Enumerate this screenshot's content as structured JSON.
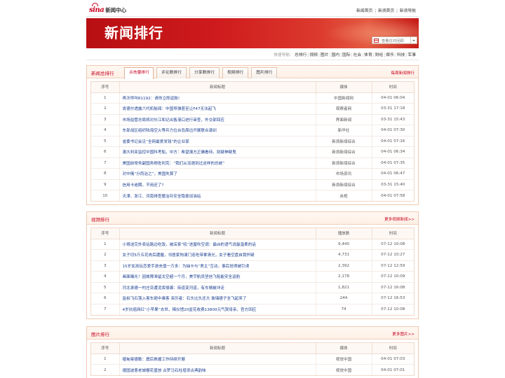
{
  "header": {
    "logo_brand": "sina",
    "logo_text": "新闻中心",
    "links": [
      "新闻首页",
      "新浪首页",
      "新浪导航"
    ],
    "link_separator": "|"
  },
  "banner": {
    "title": "新闻排行",
    "date_placeholder": "查看往日回顾"
  },
  "quicknav": {
    "label": "快速导航:",
    "items": [
      "总排行",
      "视频",
      "图片",
      "国内",
      "国际",
      "社会",
      "体育",
      "财经",
      "娱乐",
      "科技",
      "军事"
    ]
  },
  "news_panel": {
    "title": "新闻总排行",
    "more": "每周新闻排行",
    "tabs": [
      "点击量排行",
      "评论数排行",
      "分享数排行",
      "视频排行",
      "图片排行"
    ],
    "active_tab": 0,
    "columns": [
      "序号",
      "新闻标题",
      "媒体",
      "时间"
    ],
    "rows": [
      {
        "n": "1",
        "title": "再次呼叫81192：请你立即返航!",
        "media": "中国新闻网",
        "time": "04-01 06:04"
      },
      {
        "n": "2",
        "title": "肯德尔透露六代机秘闻：中国导弹甚至让F47无法起飞",
        "media": "观察者网",
        "time": "03-31 17:18"
      },
      {
        "n": "3",
        "title": "市场监管总局将对长江和记出售港口进行审查，外交部回应",
        "media": "界面新闻",
        "time": "03-31 15:43"
      },
      {
        "n": "4",
        "title": "东部战区组织陆海空火等兵力位台岛周边开展联合演训",
        "media": "新华社",
        "time": "04-01 07:30"
      },
      {
        "n": "5",
        "title": "省委书记会见“全网最爱发钱”的企业家",
        "media": "新浪新闻综合",
        "time": "04-01 07:16"
      },
      {
        "n": "6",
        "title": "澳大利亚监控中国科考船，中方：希望澳方正确看待，别疑神疑鬼",
        "media": "新浪新闻综合",
        "time": "04-01 06:34"
      },
      {
        "n": "7",
        "title": "美国前常务副国务卿佐利克：“我们从没遇到过这样的总统”",
        "media": "新浪新闻综合",
        "time": "04-01 07:35"
      },
      {
        "n": "8",
        "title": "对中俄“分而治之”，美国失算了",
        "media": "市场资讯",
        "time": "04-01 06:47"
      },
      {
        "n": "9",
        "title": "信用卡逾期，不用还了?",
        "media": "新浪新闻综合",
        "time": "03-31 15:40"
      },
      {
        "n": "10",
        "title": "天津、浙江、河南排查整治存安全隐患加油站",
        "media": "央视",
        "time": "04-01 07:58"
      }
    ]
  },
  "video_panel": {
    "title": "视频排行",
    "more": "更多视频新闻>>",
    "columns": [
      "序号",
      "新闻标题",
      "播放数",
      "时间"
    ],
    "rows": [
      {
        "n": "1",
        "title": "小哥送完外卖站路边吃饭，被店家“吼”进屋吹空调：最凶的语气说最温柔的话",
        "media": "9,440",
        "time": "07-12 10:08"
      },
      {
        "n": "2",
        "title": "女子切5斤五花肉后遭握，邻居家狗凑门连吃带拿清光，女子看空盘自我怀疑",
        "media": "4,731",
        "time": "07-12 10:27"
      },
      {
        "n": "3",
        "title": "15岁女孩玩恋爱手游充值一万多：为抽卡与“男主”互动，事后觉得被引诱",
        "media": "2,392",
        "time": "07-12 12:59"
      },
      {
        "n": "4",
        "title": "画面曝光！因故障滞留太空超一个月，美宇航员坚信飞船能安全返航",
        "media": "2,178",
        "time": "07-12 10:09"
      },
      {
        "n": "5",
        "title": "河北承德一村庄突遭泥浆侵袭：街道变河道，有车辆被冲走",
        "media": "1,821",
        "time": "07-12 16:08"
      },
      {
        "n": "6",
        "title": "监拍飞石落入客车砸中乘客 亲历者：石头比头还大 玻璃碴子全飞起来了",
        "media": "244",
        "time": "07-12 16:53"
      },
      {
        "n": "7",
        "title": "4岁抗癌网红“小苹果”去世，辣仪馆20盆花收费13800元气哭母亲，官方回应",
        "media": "74",
        "time": "07-12 10:08"
      }
    ]
  },
  "photo_panel": {
    "title": "图片排行",
    "more": "更多图片>>",
    "columns": [
      "序号",
      "新闻标题",
      "媒体",
      "时间"
    ],
    "rows": [
      {
        "n": "1",
        "title": "缅甸曼德勒：震后救援工作持续开展",
        "media": "视觉中国",
        "time": "04-01 07:03"
      },
      {
        "n": "2",
        "title": "德国波恩老城樱花盛放 古罗马石柱增添古典韵味",
        "media": "视觉中国",
        "time": "04-01 07:01"
      }
    ]
  },
  "colors": {
    "accent": "#c8001e",
    "link": "#1a3d8f",
    "banner_start": "#b70f12",
    "banner_end": "#e35b42",
    "panel_border": "#f0c9b3"
  }
}
